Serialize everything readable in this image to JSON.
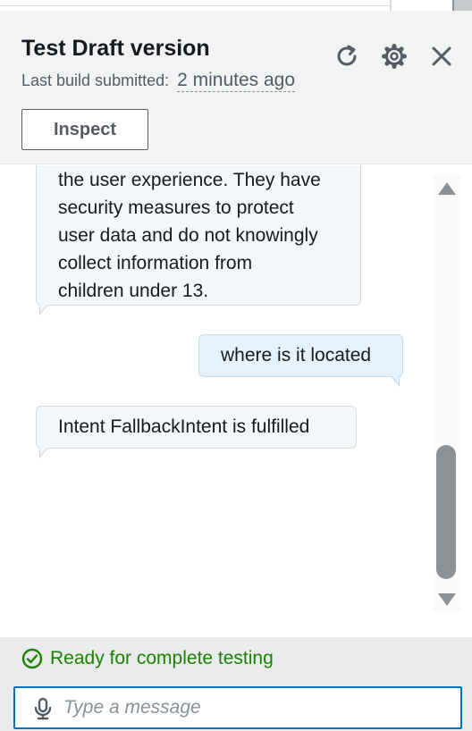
{
  "header": {
    "title": "Test Draft version",
    "build_label": "Last build submitted:",
    "build_time": "2 minutes ago",
    "inspect_label": "Inspect",
    "icons": [
      "refresh-icon",
      "settings-icon",
      "close-icon"
    ]
  },
  "chat": {
    "messages": [
      {
        "role": "bot",
        "lines": [
          "the user experience. They have",
          "security measures to protect",
          "user data and do not knowingly",
          "collect information from",
          "children under 13."
        ]
      },
      {
        "role": "user",
        "text": "where is it located"
      },
      {
        "role": "bot",
        "text": "Intent FallbackIntent is fulfilled"
      }
    ]
  },
  "status": {
    "text": "Ready for complete testing",
    "color": "#1d8102"
  },
  "input": {
    "placeholder": "Type a message",
    "value": ""
  },
  "colors": {
    "accent": "#0073bb",
    "header_bg": "#f2f3f3",
    "user_bubble": "#e6f2fb",
    "bot_bubble": "#f4f7f9"
  }
}
